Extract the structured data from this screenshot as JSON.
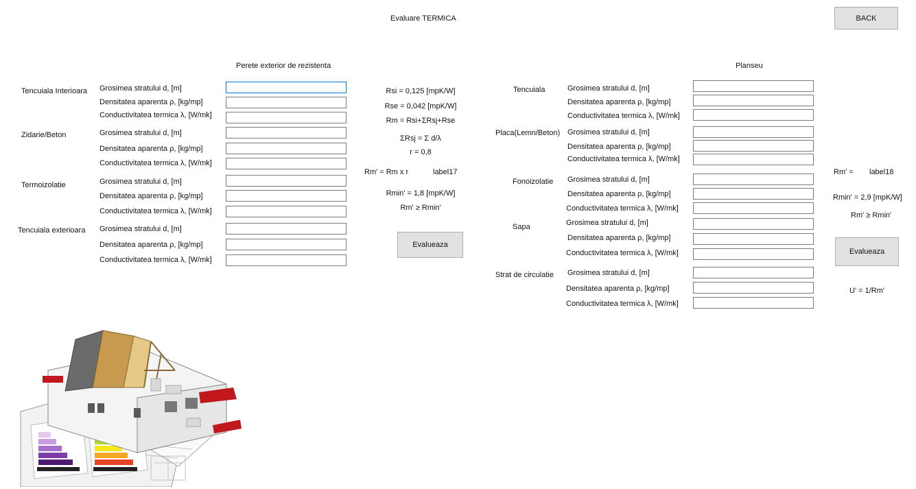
{
  "window": {
    "title": "Evaluare  TERMICA",
    "back_label": "BACK"
  },
  "wall": {
    "section_title": "Perete exterior de rezistenta",
    "layers": [
      {
        "name": "Tencuiala Interioara",
        "fields": [
          {
            "label": "Grosimea stratului d, [m]",
            "value": ""
          },
          {
            "label": "Densitatea aparenta ρ, [kg/mp]",
            "value": ""
          },
          {
            "label": "Conductivitatea termica λ, [W/mk]",
            "value": ""
          }
        ]
      },
      {
        "name": "Zidarie/Beton",
        "fields": [
          {
            "label": "Grosimea stratului d, [m]",
            "value": ""
          },
          {
            "label": "Densitatea aparenta ρ, [kg/mp]",
            "value": ""
          },
          {
            "label": "Conductivitatea termica λ, [W/mk]",
            "value": ""
          }
        ]
      },
      {
        "name": "Termoizolatie",
        "fields": [
          {
            "label": "Grosimea stratului d, [m]",
            "value": ""
          },
          {
            "label": "Densitatea aparenta ρ, [kg/mp]",
            "value": ""
          },
          {
            "label": "Conductivitatea termica λ, [W/mk]",
            "value": ""
          }
        ]
      },
      {
        "name": "Tencuiala exterioara",
        "fields": [
          {
            "label": "Grosimea stratului d, [m]",
            "value": ""
          },
          {
            "label": "Densitatea aparenta ρ, [kg/mp]",
            "value": ""
          },
          {
            "label": "Conductivitatea termica λ, [W/mk]",
            "value": ""
          }
        ]
      }
    ]
  },
  "formulas": {
    "rsi": "Rsi = 0,125 [mpK/W]",
    "rse": "Rse = 0,042 [mpK/W]",
    "rm": "Rm = Rsi+ΣRsj+Rse",
    "sum": "ΣRsj = Σ d/λ",
    "r": "r = 0,8",
    "rm_prime": "Rm' =  Rm x r",
    "result_label": "label17",
    "rmin": "Rmin' = 1,8 [mpK/W]",
    "cond": "Rm' ≥ Rmin'",
    "evaluate_label": "Evalueaza"
  },
  "floor": {
    "section_title": "Planseu",
    "layers": [
      {
        "name": "Tencuiala",
        "fields": [
          {
            "label": "Grosimea stratului d, [m]",
            "value": ""
          },
          {
            "label": "Densitatea aparenta ρ, [kg/mp]",
            "value": ""
          },
          {
            "label": "Conductivitatea termica λ, [W/mk]",
            "value": ""
          }
        ]
      },
      {
        "name": "Placa(Lemn/Beton)",
        "fields": [
          {
            "label": "Grosimea stratului d, [m]",
            "value": ""
          },
          {
            "label": "Densitatea aparenta ρ, [kg/mp]",
            "value": ""
          },
          {
            "label": "Conductivitatea termica λ, [W/mk]",
            "value": ""
          }
        ]
      },
      {
        "name": "Fonoizolatie",
        "fields": [
          {
            "label": "Grosimea stratului d, [m]",
            "value": ""
          },
          {
            "label": "Densitatea aparenta ρ, [kg/mp]",
            "value": ""
          },
          {
            "label": "Conductivitatea termica λ, [W/mk]",
            "value": ""
          }
        ]
      },
      {
        "name": "Sapa",
        "fields": [
          {
            "label": "Grosimea stratului d, [m]",
            "value": ""
          },
          {
            "label": "Densitatea aparenta ρ, [kg/mp]",
            "value": ""
          },
          {
            "label": "Conductivitatea termica λ, [W/mk]",
            "value": ""
          }
        ]
      },
      {
        "name": "Strat de circulatie",
        "fields": [
          {
            "label": "Grosimea stratului d, [m]",
            "value": ""
          },
          {
            "label": "Densitatea aparenta ρ, [kg/mp]",
            "value": ""
          },
          {
            "label": "Conductivitatea termica λ, [W/mk]",
            "value": ""
          }
        ]
      }
    ],
    "rm_prime": "Rm' =",
    "result_label": "label18",
    "rmin": "Rmin' = 2,9 [mpK/W]",
    "cond": "Rm' ≥ Rmin'",
    "evaluate_label": "Evalueaza",
    "u_formula": "U' = 1/Rm'"
  },
  "colors": {
    "input_focus": "#0078d7",
    "button_bg": "#e1e1e1",
    "roof_red": "#c0181c"
  }
}
